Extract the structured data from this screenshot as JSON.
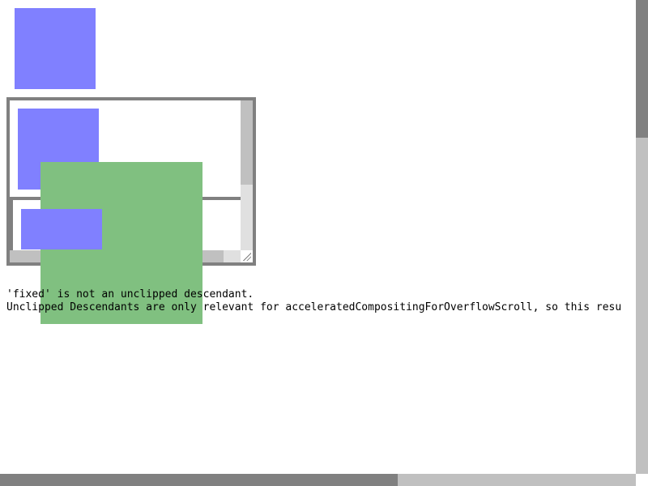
{
  "colors": {
    "blue_box": "#8080ff",
    "green_box": "#80c080",
    "border_gray": "#808080",
    "scrollbar_track": "#c0c0c0",
    "scrollbar_thumb": "#808080"
  },
  "text": {
    "line1": "'fixed' is not an unclipped descendant.",
    "line2": "Unclipped Descendants are only relevant for acceleratedCompositingForOverflowScroll, so this resu"
  }
}
